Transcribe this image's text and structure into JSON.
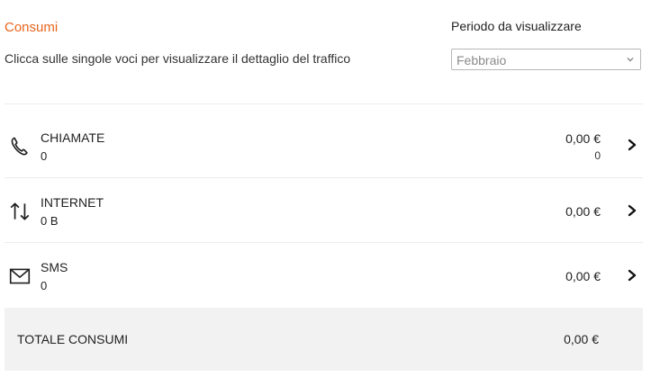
{
  "header": {
    "title": "Consumi",
    "subtitle": "Clicca sulle singole voci per visualizzare il dettaglio del traffico",
    "period_label": "Periodo da visualizzare",
    "period_selected": "Febbraio"
  },
  "items": [
    {
      "label": "CHIAMATE",
      "quantity": "0",
      "amount": "0,00 €",
      "sub_value": "0",
      "icon": "phone-icon"
    },
    {
      "label": "INTERNET",
      "quantity": "0 B",
      "amount": "0,00 €",
      "icon": "data-transfer-icon"
    },
    {
      "label": "SMS",
      "quantity": "0",
      "amount": "0,00 €",
      "icon": "envelope-icon"
    }
  ],
  "total": {
    "label": "TOTALE CONSUMI",
    "amount": "0,00 €"
  },
  "colors": {
    "accent": "#e8641e",
    "total_background": "#f2f2f2"
  }
}
